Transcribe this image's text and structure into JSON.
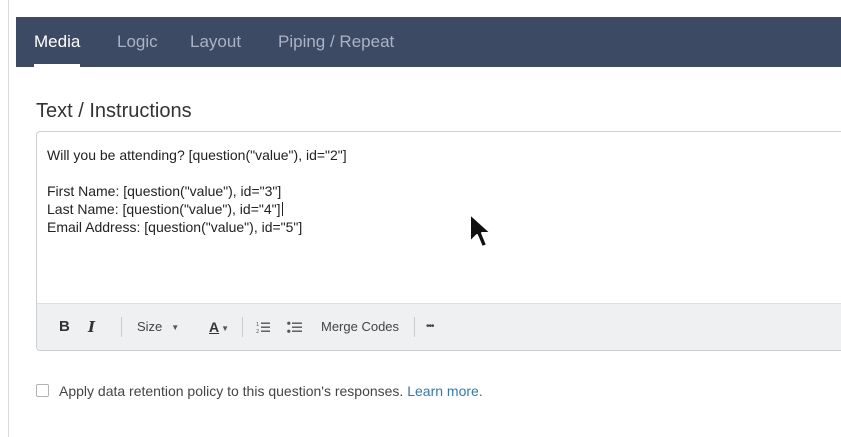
{
  "tabs": [
    {
      "label": "Media",
      "active": true
    },
    {
      "label": "Logic",
      "active": false
    },
    {
      "label": "Layout",
      "active": false
    },
    {
      "label": "Piping / Repeat",
      "active": false
    }
  ],
  "section": {
    "title": "Text / Instructions"
  },
  "editor": {
    "lines": [
      "Will you be attending? [question(\"value\"), id=\"2\"]",
      "",
      "First Name: [question(\"value\"), id=\"3\"]",
      "Last Name: [question(\"value\"), id=\"4\"]",
      "Email Address: [question(\"value\"), id=\"5\"]"
    ]
  },
  "toolbar": {
    "bold": "B",
    "italic": "I",
    "size_label": "Size",
    "font_color": "A",
    "merge_codes": "Merge Codes",
    "more": "•••"
  },
  "retention": {
    "checked": false,
    "text": "Apply data retention policy to this question's responses.",
    "link": "Learn more."
  },
  "colors": {
    "tabbar_bg": "#3d4a63",
    "link": "#2e7ab8"
  },
  "icons": [
    "ordered-list-icon",
    "unordered-list-icon",
    "chevron-down-icon",
    "mouse-pointer-icon"
  ]
}
